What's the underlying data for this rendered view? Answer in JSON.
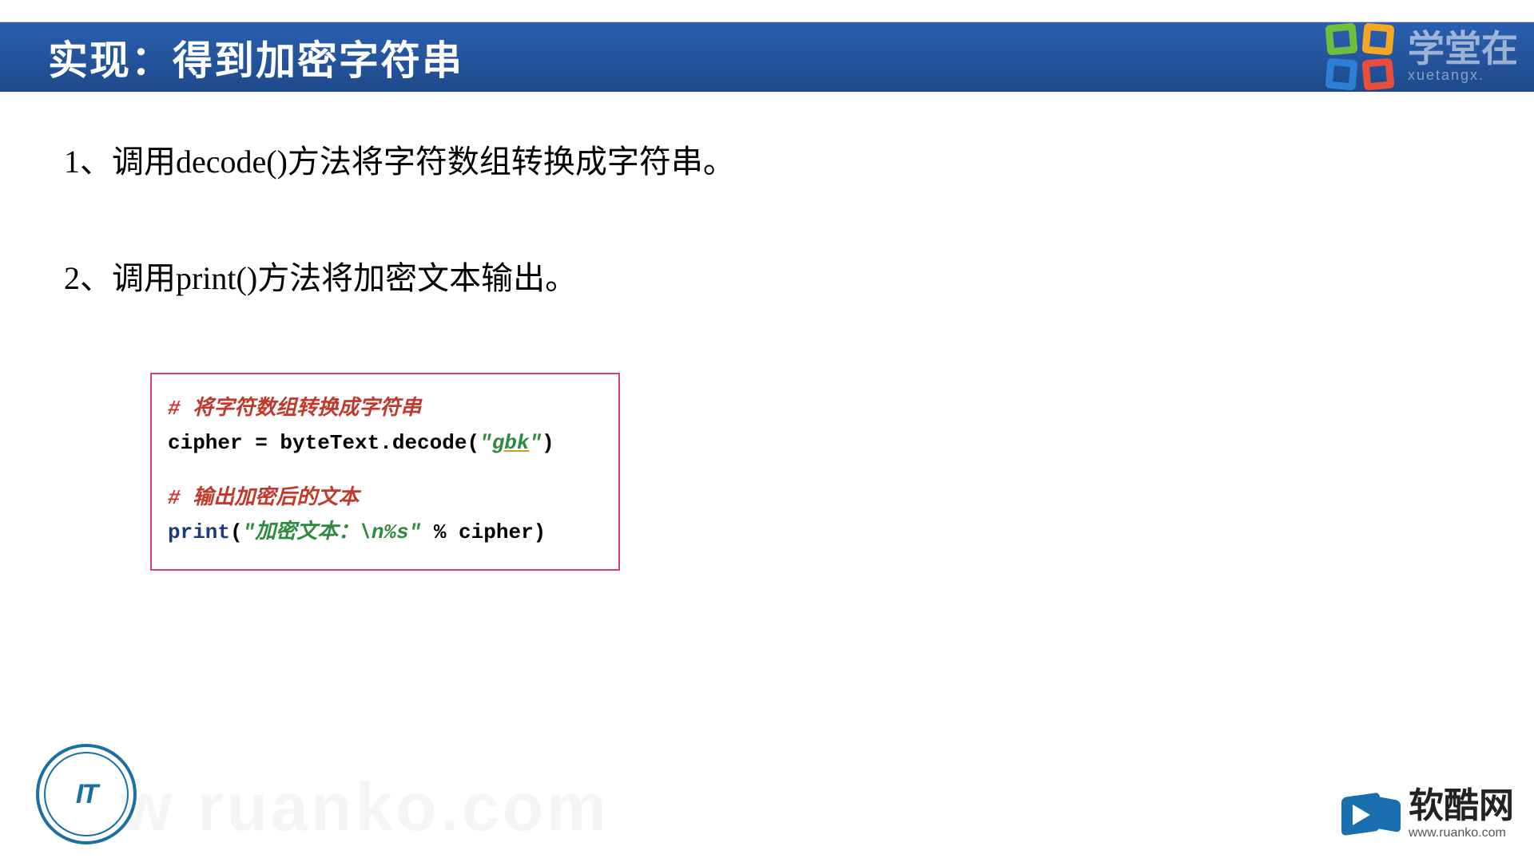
{
  "header": {
    "title": "实现：得到加密字符串"
  },
  "xuetang": {
    "cn": "学堂在",
    "en": "xuetangx."
  },
  "bullets": {
    "b1_prefix": "1、调用",
    "b1_latin": "decode()",
    "b1_suffix": "方法将字符数组转换成字符串。",
    "b2_prefix": "2、调用",
    "b2_latin": "print()",
    "b2_suffix": "方法将加密文本输出。"
  },
  "code": {
    "c1": "# 将字符数组转换成字符串",
    "l2a": "cipher = byteText.decode(",
    "l2b": "\"",
    "l2c": "gbk",
    "l2d": "\"",
    "l2e": ")",
    "c2": "# 输出加密后的文本",
    "l4a": "print",
    "l4b": "(",
    "l4c": "\"加密文本：\\n%s\"",
    "l4d": " % cipher)"
  },
  "watermark": "w ruanko.com",
  "edu_logo_text": "IT",
  "ruanko": {
    "cn": "软酷网",
    "url": "www.ruanko.com"
  }
}
